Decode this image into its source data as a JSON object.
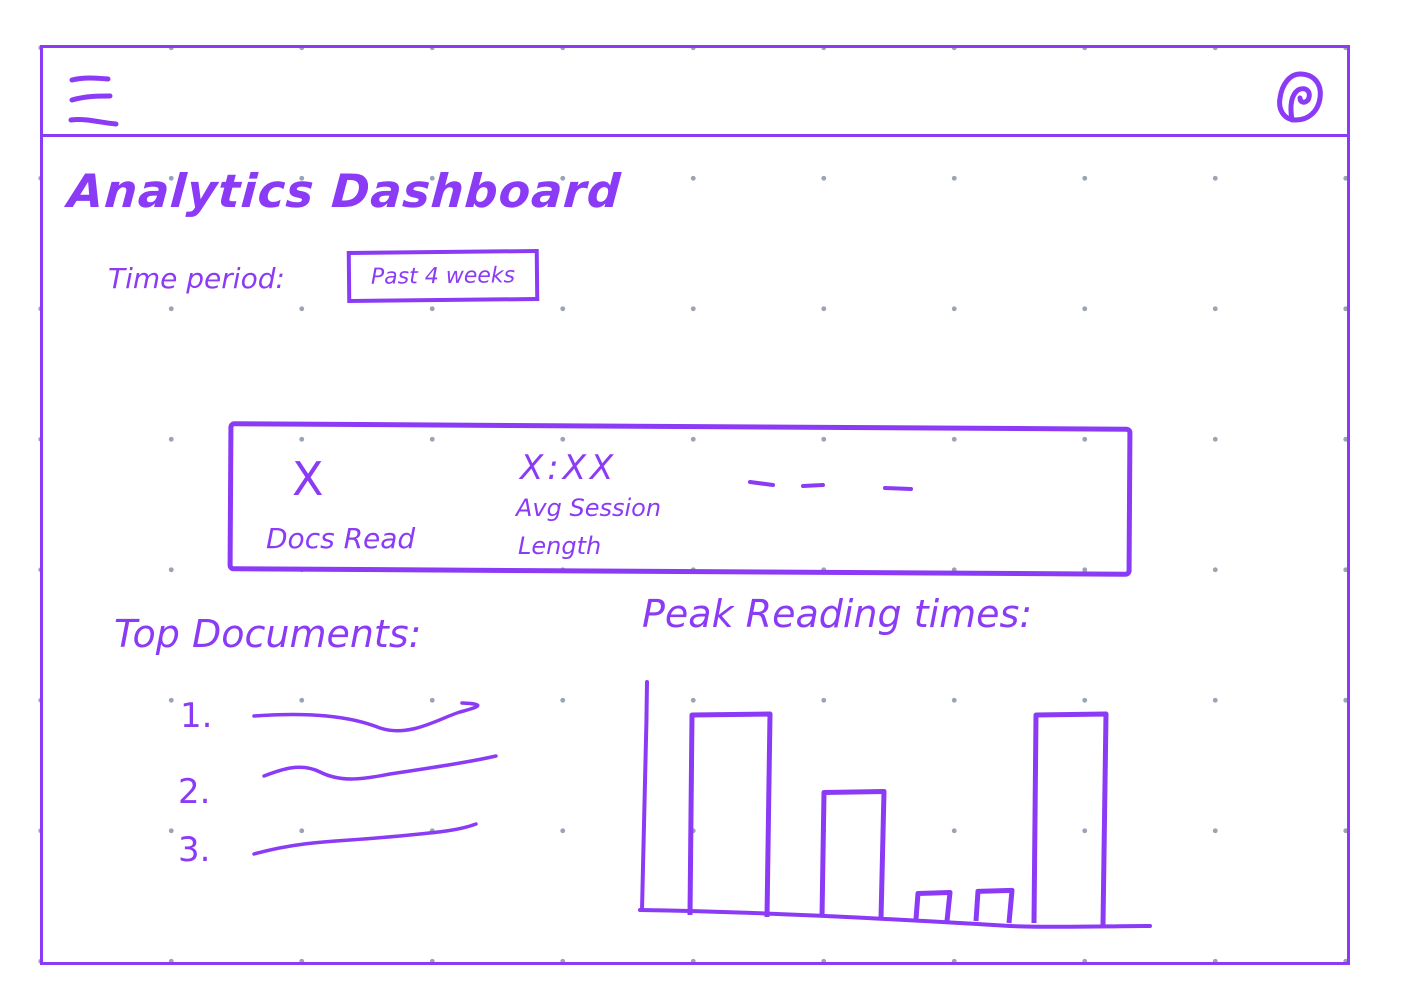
{
  "header": {
    "menu_icon": "hamburger-menu-icon",
    "user_icon": "user-avatar-icon"
  },
  "page": {
    "title": "Analytics Dashboard",
    "time_period_label": "Time period:",
    "time_period_value": "Past 4 weeks"
  },
  "stats": {
    "docs_read_value": "X",
    "docs_read_label": "Docs Read",
    "avg_session_value": "X:XX",
    "avg_session_label_line1": "Avg Session",
    "avg_session_label_line2": "Length"
  },
  "top_documents": {
    "title": "Top Documents:",
    "items": [
      {
        "number": "1."
      },
      {
        "number": "2."
      },
      {
        "number": "3."
      }
    ]
  },
  "peak_reading": {
    "title": "Peak Reading times:"
  },
  "chart_data": {
    "type": "bar",
    "title": "Peak Reading times:",
    "values": [
      0.93,
      0.57,
      0.1,
      0.11,
      0.93
    ],
    "xlabel": "",
    "ylabel": ""
  },
  "colors": {
    "ink": "#8b3bf5",
    "grid_dot": "#9aa4b4"
  }
}
